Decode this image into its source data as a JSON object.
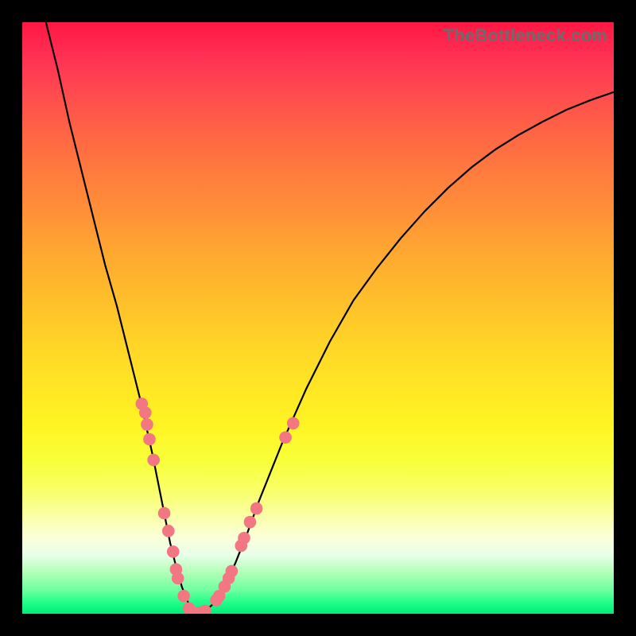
{
  "watermark": "TheBottleneck.com",
  "colors": {
    "frame": "#000000",
    "curve": "#000000",
    "dot": "#f27783"
  },
  "chart_data": {
    "type": "line",
    "title": "",
    "xlabel": "",
    "ylabel": "",
    "xlim": [
      0,
      100
    ],
    "ylim": [
      0,
      100
    ],
    "grid": false,
    "legend": false,
    "note": "Bottleneck-style V-curve over a red-to-green vertical heat gradient. Axes are unlabeled; x treated as 0–100 component index, y as 0–100 bottleneck severity (0 at bottom/green = ideal).",
    "series": [
      {
        "name": "bottleneck-curve",
        "x": [
          4,
          6,
          8,
          10,
          12,
          14,
          16,
          18,
          20,
          22,
          23,
          24,
          25,
          26,
          27,
          28,
          28.5,
          28.8,
          29,
          30,
          31,
          32,
          33,
          34,
          36,
          38,
          40,
          44,
          48,
          52,
          56,
          60,
          64,
          68,
          72,
          76,
          80,
          84,
          88,
          92,
          96,
          100
        ],
        "y": [
          100,
          92,
          83,
          75,
          67,
          59,
          52,
          44,
          36,
          27,
          22,
          17,
          12,
          8,
          4.5,
          2,
          0.8,
          0.2,
          0,
          0.1,
          0.6,
          1.4,
          2.6,
          4.2,
          8.5,
          13.5,
          19,
          29,
          38,
          46,
          53,
          58.5,
          63.5,
          68,
          72,
          75.5,
          78.5,
          81,
          83.2,
          85.2,
          86.8,
          88.2
        ]
      }
    ],
    "points": [
      {
        "x": 20.2,
        "y": 35.5
      },
      {
        "x": 20.8,
        "y": 34.0
      },
      {
        "x": 21.1,
        "y": 32.0
      },
      {
        "x": 21.5,
        "y": 29.5
      },
      {
        "x": 22.2,
        "y": 26.0
      },
      {
        "x": 24.0,
        "y": 17.0
      },
      {
        "x": 24.7,
        "y": 14.0
      },
      {
        "x": 25.5,
        "y": 10.5
      },
      {
        "x": 26.0,
        "y": 7.5
      },
      {
        "x": 26.3,
        "y": 6.0
      },
      {
        "x": 27.3,
        "y": 3.0
      },
      {
        "x": 28.2,
        "y": 0.9
      },
      {
        "x": 28.6,
        "y": 0.3
      },
      {
        "x": 29.0,
        "y": 0.0
      },
      {
        "x": 29.8,
        "y": 0.1
      },
      {
        "x": 30.2,
        "y": 0.2
      },
      {
        "x": 30.9,
        "y": 0.5
      },
      {
        "x": 32.8,
        "y": 2.3
      },
      {
        "x": 33.3,
        "y": 3.0
      },
      {
        "x": 34.2,
        "y": 4.6
      },
      {
        "x": 34.9,
        "y": 6.0
      },
      {
        "x": 35.4,
        "y": 7.2
      },
      {
        "x": 37.0,
        "y": 11.5
      },
      {
        "x": 37.5,
        "y": 12.8
      },
      {
        "x": 38.5,
        "y": 15.5
      },
      {
        "x": 39.6,
        "y": 17.8
      },
      {
        "x": 44.5,
        "y": 29.8
      },
      {
        "x": 45.8,
        "y": 32.2
      }
    ],
    "dot_radius": 1.05
  }
}
